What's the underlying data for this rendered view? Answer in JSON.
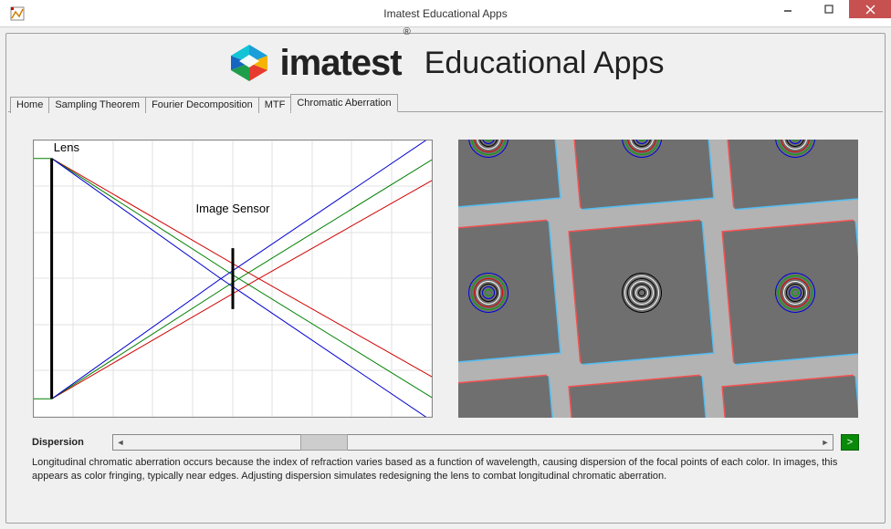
{
  "window": {
    "title": "Imatest Educational Apps"
  },
  "brand": {
    "name": "imatest",
    "reg": "®",
    "sub": "Educational Apps"
  },
  "tabs": {
    "items": [
      {
        "label": "Home"
      },
      {
        "label": "Sampling Theorem"
      },
      {
        "label": "Fourier Decomposition"
      },
      {
        "label": "MTF"
      },
      {
        "label": "Chromatic Aberration"
      }
    ],
    "active": 4
  },
  "controls": {
    "dispersion_label": "Dispersion",
    "go_label": ">",
    "slider_pos": 0.25
  },
  "description": "Longitudinal chromatic aberration occurs because the index of refraction varies based as a function of wavelength, causing dispersion of the focal points of each color. In images, this appears as color fringing, typically near edges. Adjusting dispersion simulates redesigning the lens to combat longitudinal chromatic aberration.",
  "chart_data": {
    "type": "line",
    "title": "",
    "xlabel": "",
    "ylabel": "",
    "xlim": [
      0,
      10
    ],
    "ylim": [
      -5,
      5
    ],
    "annotations": [
      {
        "text": "Lens",
        "x": 0.5,
        "y": 4.6
      },
      {
        "text": "Image Sensor",
        "x": 5.0,
        "y": 2.4
      }
    ],
    "lens_x": 0.45,
    "lens_top": 4.35,
    "lens_bottom": -4.35,
    "sensor_x": 5.0,
    "sensor_top": 1.1,
    "sensor_bottom": -1.1,
    "series": [
      {
        "name": "red-top",
        "color": "#d00000",
        "x": [
          0.45,
          5.65,
          10
        ],
        "y": [
          4.35,
          0,
          3.55
        ]
      },
      {
        "name": "red-bot",
        "color": "#d00000",
        "x": [
          0.45,
          5.65,
          10
        ],
        "y": [
          -4.35,
          0,
          -3.55
        ]
      },
      {
        "name": "green-top",
        "color": "#008000",
        "x": [
          0.45,
          5.15,
          10
        ],
        "y": [
          4.35,
          0,
          4.3
        ]
      },
      {
        "name": "green-bot",
        "color": "#008000",
        "x": [
          0.45,
          5.15,
          10
        ],
        "y": [
          -4.35,
          0,
          -4.3
        ]
      },
      {
        "name": "blue-top",
        "color": "#0000d0",
        "x": [
          0.45,
          4.7,
          10
        ],
        "y": [
          4.35,
          0,
          5.15
        ]
      },
      {
        "name": "blue-bot",
        "color": "#0000d0",
        "x": [
          0.45,
          4.7,
          10
        ],
        "y": [
          -4.35,
          0,
          -5.15
        ]
      }
    ],
    "guides": [
      {
        "name": "lens-top-green",
        "color": "#008000",
        "x": [
          0,
          0.45
        ],
        "y": [
          4.35,
          4.35
        ]
      },
      {
        "name": "lens-bottom-green",
        "color": "#008000",
        "x": [
          0,
          0.45
        ],
        "y": [
          -4.35,
          -4.35
        ]
      }
    ]
  },
  "preview": {
    "tile_fringe_colors": {
      "top_left": "#ff4040",
      "bottom_right": "#40c0ff"
    }
  }
}
